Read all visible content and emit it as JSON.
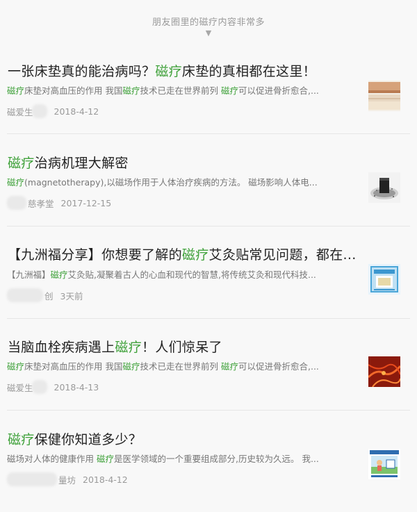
{
  "header": {
    "title": "朋友圈里的磁疗内容非常多",
    "arrow": "▼"
  },
  "articles": [
    {
      "title_parts": [
        {
          "text": "一张床垫真的能治病吗？",
          "hl": false
        },
        {
          "text": "磁疗",
          "hl": true
        },
        {
          "text": "床垫的真相都在这里！",
          "hl": false
        }
      ],
      "snippet_parts": [
        {
          "text": "磁疗",
          "hl": true
        },
        {
          "text": "床垫对高血压的作用  我国",
          "hl": false
        },
        {
          "text": "磁疗",
          "hl": true
        },
        {
          "text": "技术已走在世界前列  ",
          "hl": false
        },
        {
          "text": "磁疗",
          "hl": true
        },
        {
          "text": "可以促进骨折愈合,...",
          "hl": false
        }
      ],
      "source": "磁爱生",
      "date": "2018-4-12",
      "thumb_icon": "mattress-photo-icon"
    },
    {
      "title_parts": [
        {
          "text": "磁疗",
          "hl": true
        },
        {
          "text": "治病机理大解密",
          "hl": false
        }
      ],
      "snippet_parts": [
        {
          "text": "磁疗",
          "hl": true
        },
        {
          "text": "(magnetotherapy),以磁场作用于人体治疗疾病的方法。  磁场影响人体电...",
          "hl": false
        }
      ],
      "source": "慈孝堂",
      "date": "2017-12-15",
      "thumb_icon": "magnet-device-photo-icon"
    },
    {
      "title_parts": [
        {
          "text": "【九洲福分享】你想要了解的",
          "hl": false
        },
        {
          "text": "磁疗",
          "hl": true
        },
        {
          "text": "艾灸贴常见问题，都在...",
          "hl": false
        }
      ],
      "snippet_parts": [
        {
          "text": "【九洲福】",
          "hl": false
        },
        {
          "text": "磁疗",
          "hl": true
        },
        {
          "text": "艾灸贴,凝聚着古人的心血和现代的智慧,将传统艾灸和现代科技...",
          "hl": false
        }
      ],
      "source": "创",
      "date": "3天前",
      "thumb_icon": "moxibustion-patch-box-icon"
    },
    {
      "title_parts": [
        {
          "text": "当脑血栓疾病遇上",
          "hl": false
        },
        {
          "text": "磁疗",
          "hl": true
        },
        {
          "text": "！人们惊呆了",
          "hl": false
        }
      ],
      "snippet_parts": [
        {
          "text": "磁疗",
          "hl": true
        },
        {
          "text": "床垫对高血压的作用  我国",
          "hl": false
        },
        {
          "text": "磁疗",
          "hl": true
        },
        {
          "text": "技术已走在世界前列  ",
          "hl": false
        },
        {
          "text": "磁疗",
          "hl": true
        },
        {
          "text": "可以促进骨折愈合,...",
          "hl": false
        }
      ],
      "source": "磁爱生",
      "date": "2018-4-13",
      "thumb_icon": "blood-vessel-photo-icon"
    },
    {
      "title_parts": [
        {
          "text": "磁疗",
          "hl": true
        },
        {
          "text": "保健你知道多少？",
          "hl": false
        }
      ],
      "snippet_parts": [
        {
          "text": "磁场对人体的健康作用  ",
          "hl": false
        },
        {
          "text": "磁疗",
          "hl": true
        },
        {
          "text": "是医学领域的一个重要组成部分,历史较为久远。  我...",
          "hl": false
        }
      ],
      "source": "量坊",
      "date": "2018-4-12",
      "thumb_icon": "health-poster-icon"
    }
  ]
}
